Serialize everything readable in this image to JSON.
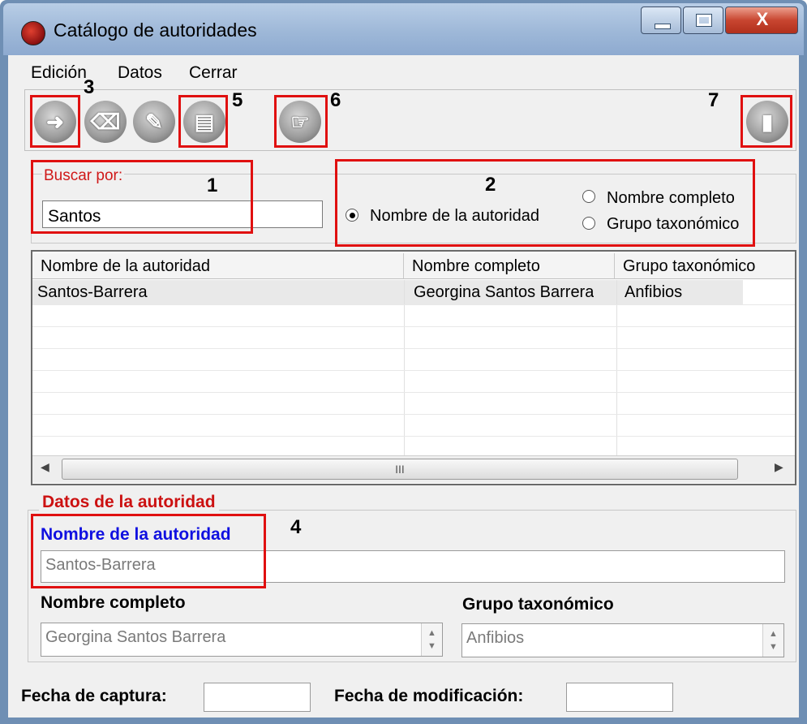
{
  "window": {
    "title": "Catálogo de autoridades",
    "controls": {
      "minimize": "minimize-icon",
      "maximize": "maximize-icon",
      "close": "X"
    }
  },
  "menu": [
    "Edición",
    "Datos",
    "Cerrar"
  ],
  "toolbar": {
    "buttons": [
      "new-record-icon",
      "erase-icon",
      "edit-icon",
      "save-icon",
      "select-icon",
      "exit-icon"
    ]
  },
  "annotations": [
    "1",
    "2",
    "3",
    "4",
    "5",
    "6",
    "7"
  ],
  "search": {
    "label": "Buscar por:",
    "value": "Santos",
    "options": [
      {
        "label": "Nombre de la autoridad",
        "selected": true
      },
      {
        "label": "Nombre completo",
        "selected": false
      },
      {
        "label": "Grupo taxonómico",
        "selected": false
      }
    ]
  },
  "grid": {
    "columns": [
      "Nombre de la autoridad",
      "Nombre completo",
      "Grupo taxonómico"
    ],
    "rows": [
      [
        "Santos-Barrera",
        "Georgina Santos Barrera",
        "Anfibios"
      ]
    ],
    "scroll_thumb": "III"
  },
  "details": {
    "title": "Datos de la autoridad",
    "autoridad_label": "Nombre de la autoridad",
    "autoridad_value": "Santos-Barrera",
    "nombre_completo_label": "Nombre completo",
    "nombre_completo_value": "Georgina Santos Barrera",
    "grupo_label": "Grupo taxonómico",
    "grupo_value": "Anfibios"
  },
  "dates": {
    "captura_label": "Fecha de captura:",
    "captura_value": "",
    "modificacion_label": "Fecha de modificación:",
    "modificacion_value": ""
  },
  "colors": {
    "annotation_box": "#e01010",
    "group_title": "#cc1111",
    "field_label_blue": "#1010e0"
  }
}
